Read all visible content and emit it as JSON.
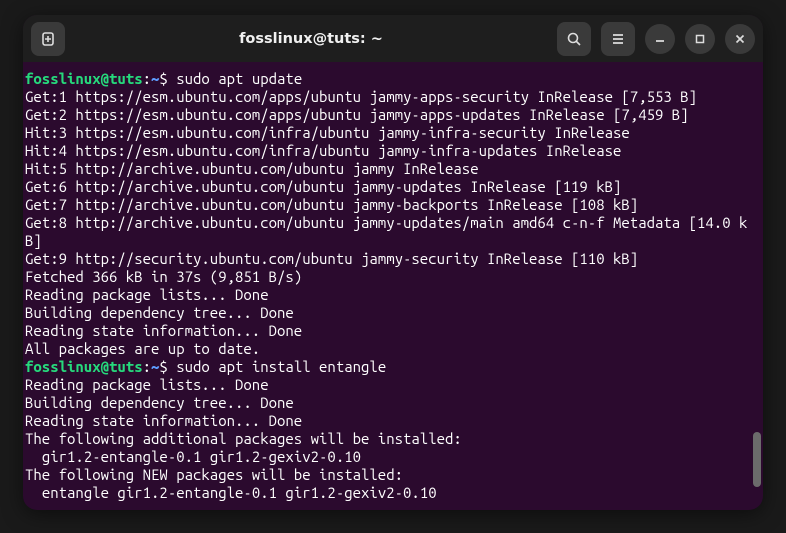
{
  "titlebar": {
    "title": "fosslinux@tuts: ~"
  },
  "prompt": {
    "user": "fosslinux@tuts",
    "colon": ":",
    "path": "~",
    "dollar": "$"
  },
  "commands": {
    "cmd1": "sudo apt update",
    "cmd2": "sudo apt install entangle"
  },
  "output": {
    "l1": "Get:1 https://esm.ubuntu.com/apps/ubuntu jammy-apps-security InRelease [7,553 B]",
    "l2": "Get:2 https://esm.ubuntu.com/apps/ubuntu jammy-apps-updates InRelease [7,459 B]",
    "l3": "Hit:3 https://esm.ubuntu.com/infra/ubuntu jammy-infra-security InRelease",
    "l4": "Hit:4 https://esm.ubuntu.com/infra/ubuntu jammy-infra-updates InRelease",
    "l5": "Hit:5 http://archive.ubuntu.com/ubuntu jammy InRelease",
    "l6": "Get:6 http://archive.ubuntu.com/ubuntu jammy-updates InRelease [119 kB]",
    "l7": "Get:7 http://archive.ubuntu.com/ubuntu jammy-backports InRelease [108 kB]",
    "l8": "Get:8 http://archive.ubuntu.com/ubuntu jammy-updates/main amd64 c-n-f Metadata [14.0 kB]",
    "l9": "Get:9 http://security.ubuntu.com/ubuntu jammy-security InRelease [110 kB]",
    "l10": "Fetched 366 kB in 37s (9,851 B/s)",
    "l11": "Reading package lists... Done",
    "l12": "Building dependency tree... Done",
    "l13": "Reading state information... Done",
    "l14": "All packages are up to date.",
    "l15": "Reading package lists... Done",
    "l16": "Building dependency tree... Done",
    "l17": "Reading state information... Done",
    "l18": "The following additional packages will be installed:",
    "l19": "  gir1.2-entangle-0.1 gir1.2-gexiv2-0.10",
    "l20": "The following NEW packages will be installed:",
    "l21": "  entangle gir1.2-entangle-0.1 gir1.2-gexiv2-0.10"
  }
}
